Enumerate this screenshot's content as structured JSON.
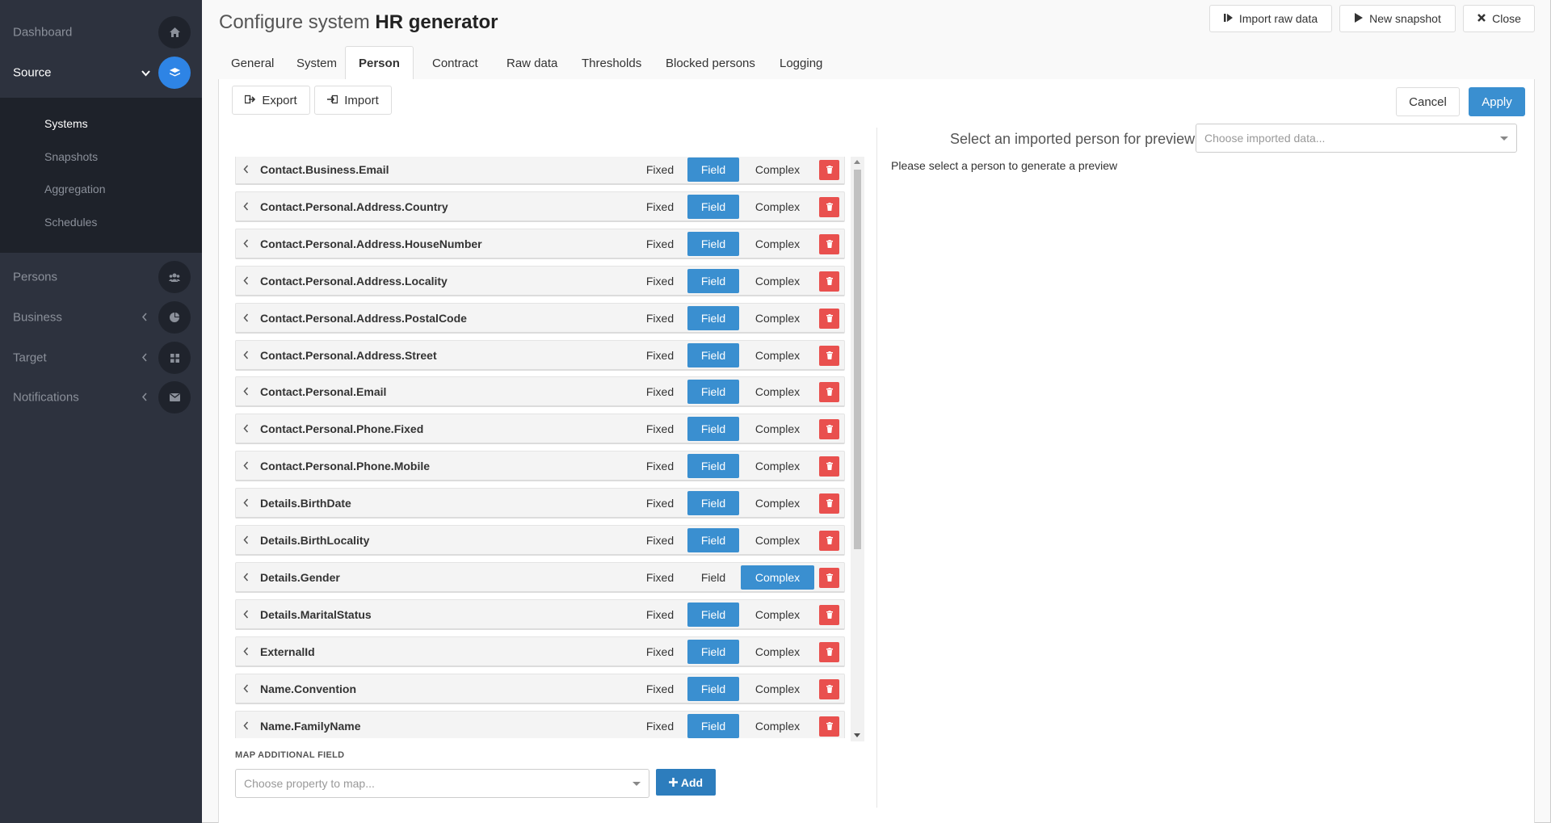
{
  "sidebar": {
    "items": [
      {
        "label": "Dashboard",
        "icon": "home-icon"
      },
      {
        "label": "Source",
        "icon": "layers-icon"
      },
      {
        "label": "Persons",
        "icon": "users-icon"
      },
      {
        "label": "Business",
        "icon": "pie-chart-icon"
      },
      {
        "label": "Target",
        "icon": "grid-icon"
      },
      {
        "label": "Notifications",
        "icon": "envelope-icon"
      }
    ],
    "subitems": [
      "Systems",
      "Snapshots",
      "Aggregation",
      "Schedules"
    ]
  },
  "header": {
    "title_prefix": "Configure system",
    "title_name": "HR generator",
    "import_raw_label": "Import raw data",
    "new_snapshot_label": "New snapshot",
    "close_label": "Close"
  },
  "tabs": [
    "General",
    "System",
    "Person",
    "Contract",
    "Raw data",
    "Thresholds",
    "Blocked persons",
    "Logging"
  ],
  "toolbar": {
    "export_label": "Export",
    "import_label": "Import",
    "cancel_label": "Cancel",
    "apply_label": "Apply"
  },
  "preview": {
    "label": "Select an imported person for preview",
    "select_placeholder": "Choose imported data...",
    "message": "Please select a person to generate a preview"
  },
  "options": {
    "fixed": "Fixed",
    "field": "Field",
    "complex": "Complex"
  },
  "fields": [
    {
      "name": "Contact.Business.Email",
      "selected": "Field"
    },
    {
      "name": "Contact.Personal.Address.Country",
      "selected": "Field"
    },
    {
      "name": "Contact.Personal.Address.HouseNumber",
      "selected": "Field"
    },
    {
      "name": "Contact.Personal.Address.Locality",
      "selected": "Field"
    },
    {
      "name": "Contact.Personal.Address.PostalCode",
      "selected": "Field"
    },
    {
      "name": "Contact.Personal.Address.Street",
      "selected": "Field"
    },
    {
      "name": "Contact.Personal.Email",
      "selected": "Field"
    },
    {
      "name": "Contact.Personal.Phone.Fixed",
      "selected": "Field"
    },
    {
      "name": "Contact.Personal.Phone.Mobile",
      "selected": "Field"
    },
    {
      "name": "Details.BirthDate",
      "selected": "Field"
    },
    {
      "name": "Details.BirthLocality",
      "selected": "Field"
    },
    {
      "name": "Details.Gender",
      "selected": "Complex"
    },
    {
      "name": "Details.MaritalStatus",
      "selected": "Field"
    },
    {
      "name": "ExternalId",
      "selected": "Field"
    },
    {
      "name": "Name.Convention",
      "selected": "Field"
    },
    {
      "name": "Name.FamilyName",
      "selected": "Field"
    }
  ],
  "map_additional": {
    "label": "MAP ADDITIONAL FIELD",
    "placeholder": "Choose property to map...",
    "add_label": "Add"
  },
  "colors": {
    "accent": "#3a8fd0",
    "danger": "#e9504e",
    "sidebar": "#2d323e"
  }
}
